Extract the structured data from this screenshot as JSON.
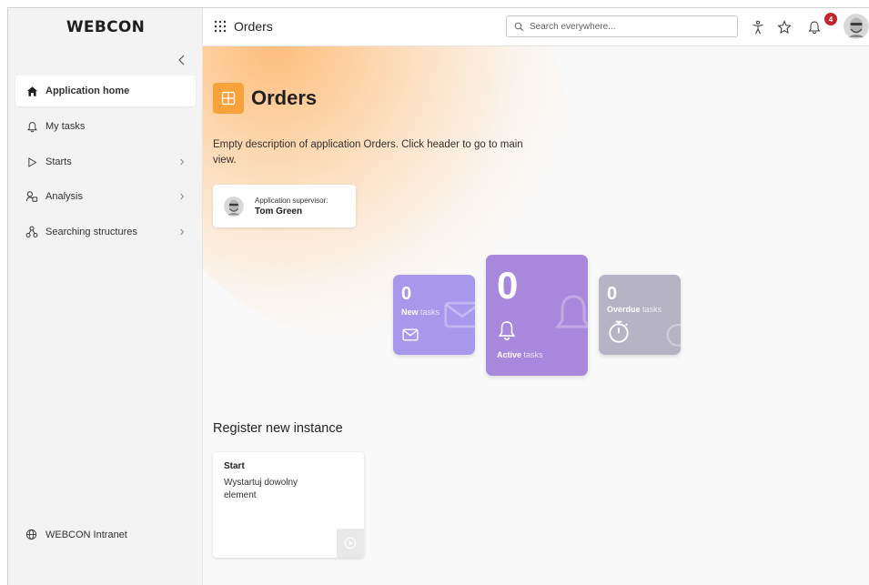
{
  "logo": {
    "text": "WEBCON"
  },
  "sidebar": {
    "items": [
      {
        "label": "Application home",
        "icon": "home-icon",
        "active": true
      },
      {
        "label": "My tasks",
        "icon": "bell-icon"
      },
      {
        "label": "Starts",
        "icon": "play-icon"
      },
      {
        "label": "Analysis",
        "icon": "analysis-icon"
      },
      {
        "label": "Searching structures",
        "icon": "structure-icon"
      }
    ],
    "bottom": {
      "label": "WEBCON Intranet",
      "icon": "globe-icon"
    }
  },
  "topbar": {
    "title": "Orders",
    "search_placeholder": "Search everywhere...",
    "notifications_count": "4"
  },
  "app": {
    "name": "Orders",
    "description": "Empty description of application Orders. Click header to go to main view.",
    "supervisor_label": "Application supervisor:",
    "supervisor_name": "Tom Green"
  },
  "tiles": {
    "new": {
      "count": "0",
      "label_bold": "New",
      "label_rest": " tasks"
    },
    "active": {
      "count": "0",
      "label_bold": "Active",
      "label_rest": " tasks"
    },
    "overdue": {
      "count": "0",
      "label_bold": "Overdue",
      "label_rest": " tasks"
    }
  },
  "register": {
    "title": "Register new instance",
    "card_title": "Start",
    "card_description": "Wystartuj dowolny element"
  },
  "colors": {
    "accent": "#f7a23b",
    "new_tile": "#a898ec",
    "active_tile": "#a888dc",
    "overdue_tile": "#b6b4c4",
    "badge": "#c4262e"
  }
}
